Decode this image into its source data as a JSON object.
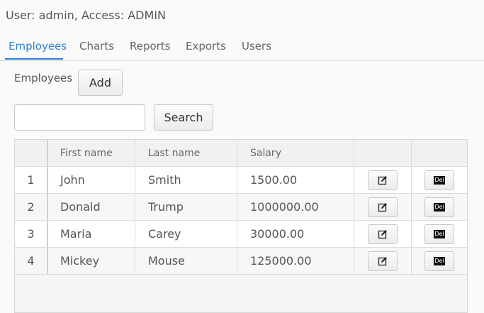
{
  "user_line": "User: admin, Access: ADMIN",
  "tabs": [
    {
      "label": "Employees",
      "active": true
    },
    {
      "label": "Charts"
    },
    {
      "label": "Reports"
    },
    {
      "label": "Exports"
    },
    {
      "label": "Users"
    }
  ],
  "section": {
    "label": "Employees",
    "add_label": "Add"
  },
  "search": {
    "value": "",
    "button_label": "Search"
  },
  "table": {
    "columns": [
      "",
      "First name",
      "Last name",
      "Salary",
      "",
      ""
    ],
    "rows": [
      {
        "index": "1",
        "first": "John",
        "last": "Smith",
        "salary": "1500.00"
      },
      {
        "index": "2",
        "first": "Donald",
        "last": "Trump",
        "salary": "1000000.00"
      },
      {
        "index": "3",
        "first": "Maria",
        "last": "Carey",
        "salary": "30000.00"
      },
      {
        "index": "4",
        "first": "Mickey",
        "last": "Mouse",
        "salary": "125000.00"
      }
    ],
    "edit_icon": "edit-icon",
    "delete_icon_label": "Del"
  },
  "colors": {
    "accent": "#2f7fd8"
  }
}
